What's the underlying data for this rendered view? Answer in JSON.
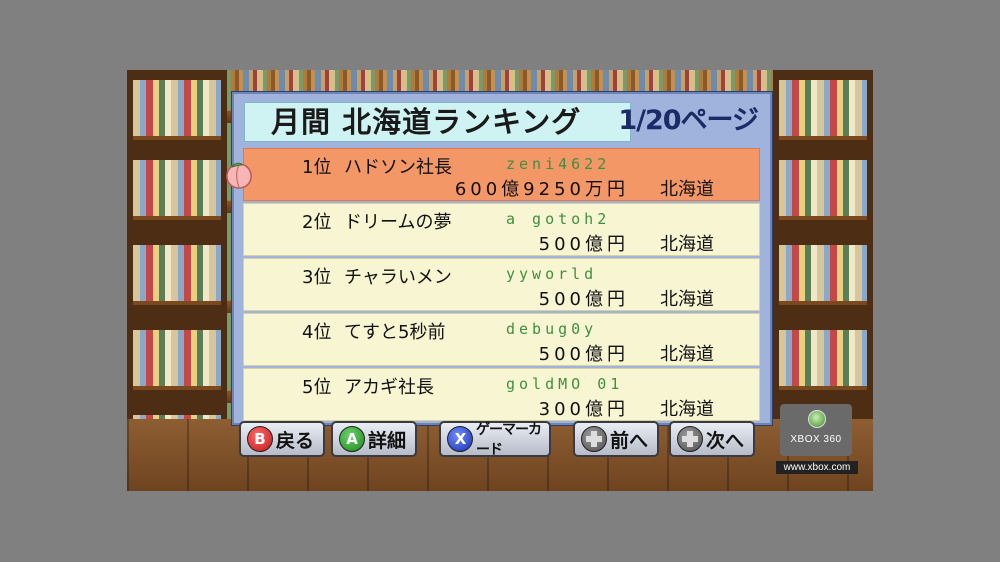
{
  "title": "月間 北海道ランキング",
  "page_indicator": "1/20ページ",
  "rankings": [
    {
      "rank": "1位",
      "name": "ハドソン社長",
      "gamertag": "zeni4622",
      "amount": "600億9250万円",
      "region": "北海道",
      "selected": true
    },
    {
      "rank": "2位",
      "name": "ドリームの夢",
      "gamertag": "a gotoh2",
      "amount": "500億円",
      "region": "北海道",
      "selected": false
    },
    {
      "rank": "3位",
      "name": "チャラいメン",
      "gamertag": "yyworld",
      "amount": "500億円",
      "region": "北海道",
      "selected": false
    },
    {
      "rank": "4位",
      "name": "てすと5秒前",
      "gamertag": "debug0y",
      "amount": "500億円",
      "region": "北海道",
      "selected": false
    },
    {
      "rank": "5位",
      "name": "アカギ社長",
      "gamertag": "goldMO 01",
      "amount": "300億円",
      "region": "北海道",
      "selected": false
    }
  ],
  "buttons": {
    "back": {
      "key": "B",
      "label": "戻る"
    },
    "details": {
      "key": "A",
      "label": "詳細"
    },
    "gamercard": {
      "key": "X",
      "label": "ゲーマーカード"
    },
    "prev": {
      "label": "前へ"
    },
    "next": {
      "label": "次へ"
    }
  },
  "xbox": {
    "logo_text": "XBOX 360",
    "url": "www.xbox.com"
  },
  "colors": {
    "panel": "#9fb3dc",
    "row": "#f8f5d2",
    "selected_row": "#f49767",
    "title_box": "#cff2f2"
  }
}
